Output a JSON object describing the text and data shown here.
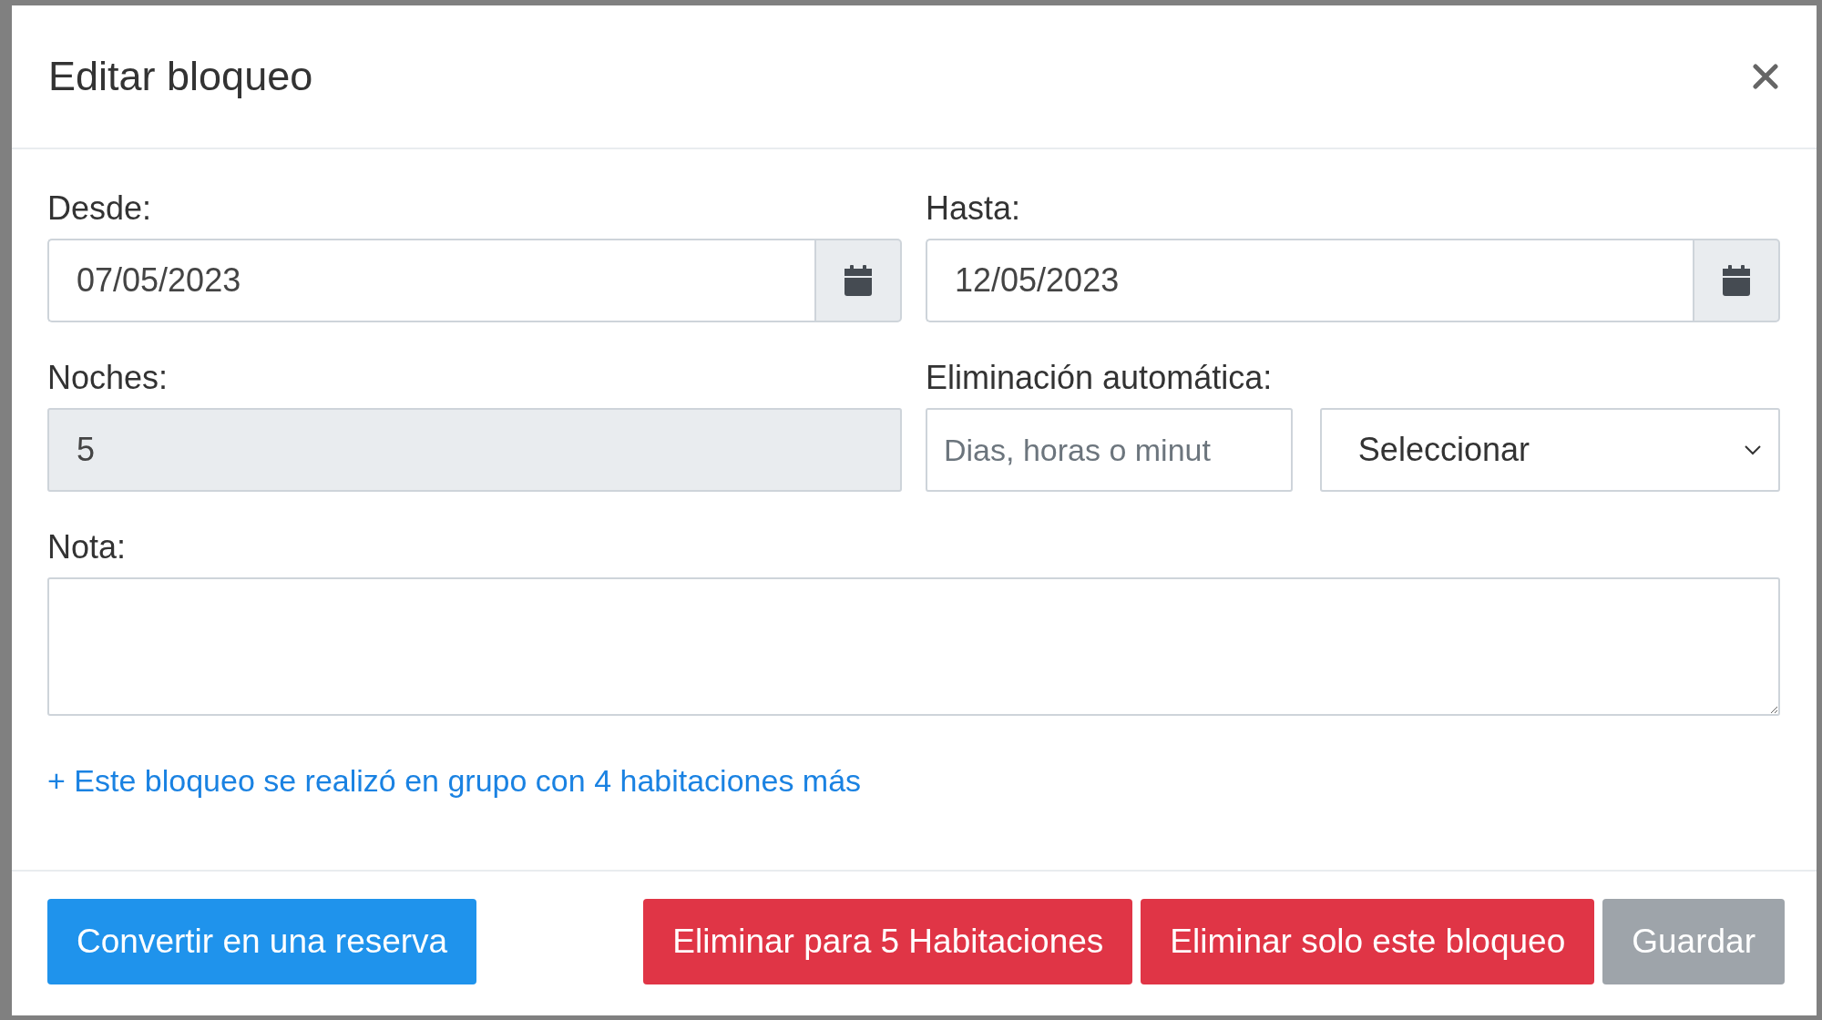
{
  "dialog": {
    "title": "Editar bloqueo"
  },
  "fields": {
    "from": {
      "label": "Desde:",
      "value": "07/05/2023"
    },
    "to": {
      "label": "Hasta:",
      "value": "12/05/2023"
    },
    "nights": {
      "label": "Noches:",
      "value": "5",
      "disabled": true
    },
    "auto_delete": {
      "label": "Eliminación automática:",
      "placeholder": "Dias, horas o minut",
      "select_value": "Seleccionar"
    },
    "note": {
      "label": "Nota:"
    }
  },
  "group_link": "+ Este bloqueo se realizó en grupo con 4 habitaciones más",
  "buttons": [
    {
      "label": "Convertir en una reserva",
      "kind": "primary"
    },
    {
      "label": "Eliminar para 5 Habitaciones",
      "kind": "danger"
    },
    {
      "label": "Eliminar solo este bloqueo",
      "kind": "danger"
    },
    {
      "label": "Guardar",
      "kind": "secondary"
    }
  ]
}
